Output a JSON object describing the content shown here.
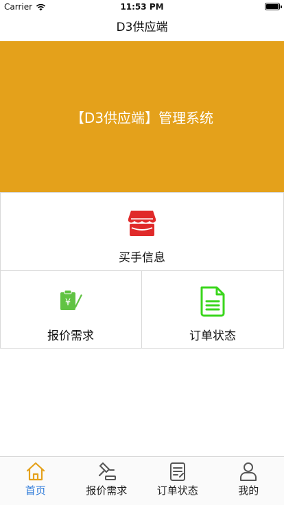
{
  "status_bar": {
    "carrier": "Carrier",
    "time": "11:53 PM"
  },
  "nav": {
    "title": "D3供应端"
  },
  "banner": {
    "text": "【D3供应端】管理系统",
    "color": "#e4a11b"
  },
  "grid": {
    "buyer_info": {
      "label": "买手信息",
      "icon": "storefront-icon",
      "color": "#e02a2a"
    },
    "quote_demand": {
      "label": "报价需求",
      "icon": "price-quote-icon",
      "color": "#61c343"
    },
    "order_status": {
      "label": "订单状态",
      "icon": "document-icon",
      "color": "#3ad61c"
    }
  },
  "tabbar": {
    "accent": "#e4a11b",
    "items": [
      {
        "label": "首页",
        "icon": "home-icon",
        "active": true
      },
      {
        "label": "报价需求",
        "icon": "gavel-icon",
        "active": false
      },
      {
        "label": "订单状态",
        "icon": "order-list-icon",
        "active": false
      },
      {
        "label": "我的",
        "icon": "person-icon",
        "active": false
      }
    ]
  }
}
